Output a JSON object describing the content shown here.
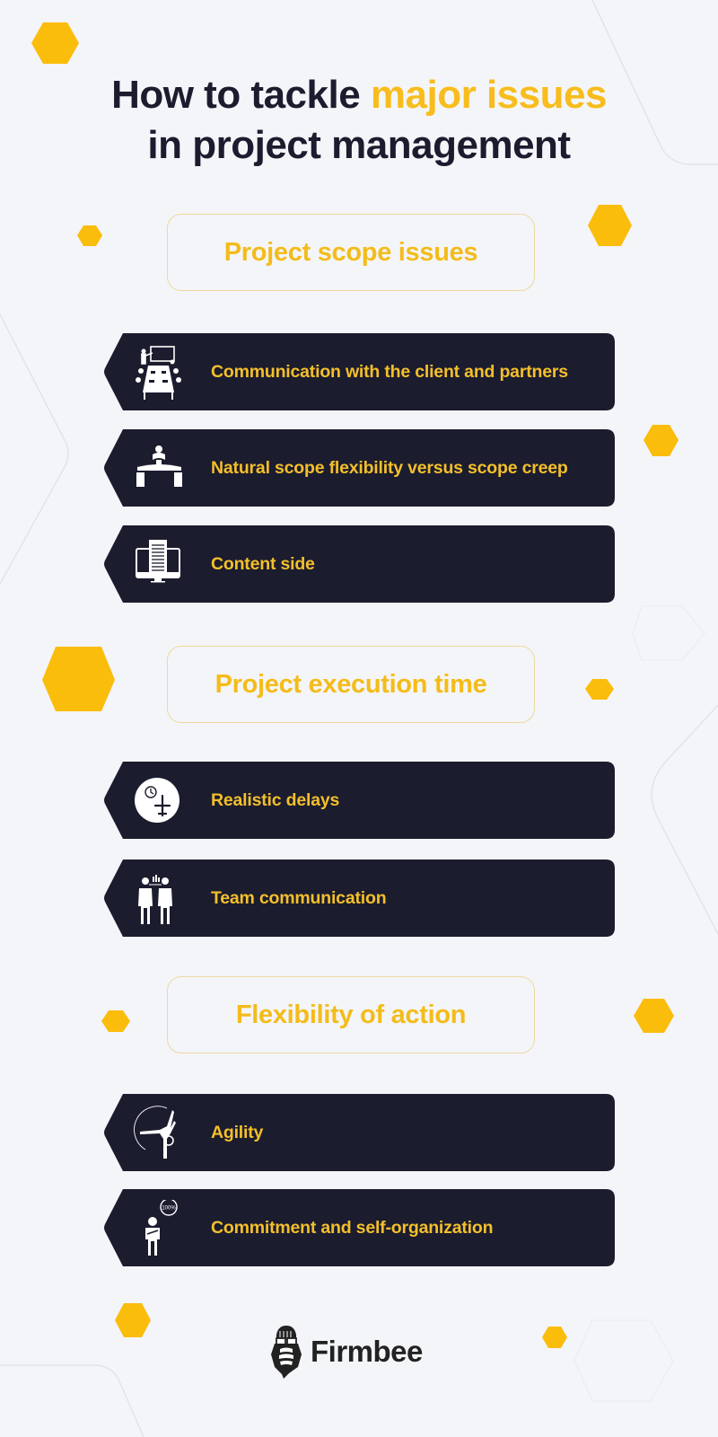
{
  "title": {
    "part1": "How to tackle ",
    "accent": "major issues",
    "line2": "in project management"
  },
  "colors": {
    "background": "#f4f5f9",
    "dark": "#1b1c2e",
    "accent": "#f8bd1c",
    "item_background": "#1b1c2e",
    "item_text": "#f4bf2b",
    "box_border": "#ecd9a0"
  },
  "sections": [
    {
      "heading": "Project scope issues",
      "items": [
        {
          "label": "Communication with the client and partners",
          "icon": "meeting-room-icon"
        },
        {
          "label": "Natural scope flexibility versus scope creep",
          "icon": "person-balancing-desks-icon"
        },
        {
          "label": "Content side",
          "icon": "document-monitor-icon"
        }
      ]
    },
    {
      "heading": "Project execution time",
      "items": [
        {
          "label": "Realistic delays",
          "icon": "clock-airplane-icon"
        },
        {
          "label": "Team communication",
          "icon": "two-workers-icon"
        }
      ]
    },
    {
      "heading": "Flexibility of action",
      "items": [
        {
          "label": "Agility",
          "icon": "acrobat-figure-icon"
        },
        {
          "label": "Commitment and self-organization",
          "icon": "person-100-percent-icon"
        }
      ]
    }
  ],
  "commitment_badge": "100%",
  "brand": {
    "name": "Firmbee",
    "logo_icon": "bee-mascot-icon"
  }
}
